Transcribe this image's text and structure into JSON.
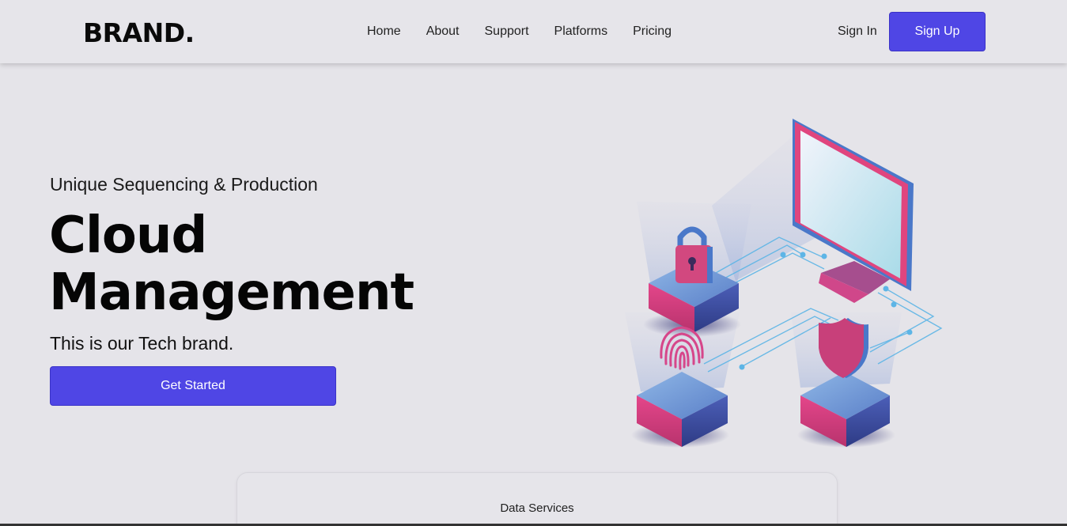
{
  "header": {
    "brand": "BRAND.",
    "nav": [
      "Home",
      "About",
      "Support",
      "Platforms",
      "Pricing"
    ],
    "sign_in": "Sign In",
    "sign_up": "Sign Up"
  },
  "hero": {
    "subtitle": "Unique Sequencing & Production",
    "title_line1": "Cloud",
    "title_line2": "Management",
    "description": "This is our Tech brand.",
    "cta": "Get Started"
  },
  "card": {
    "title": "Data Services"
  },
  "colors": {
    "accent": "#4f46e5",
    "background": "#e5e4e9",
    "pink": "#e0457e",
    "blue": "#4a78c9"
  },
  "icons": [
    "lock-icon",
    "fingerprint-icon",
    "shield-icon",
    "monitor-icon"
  ]
}
